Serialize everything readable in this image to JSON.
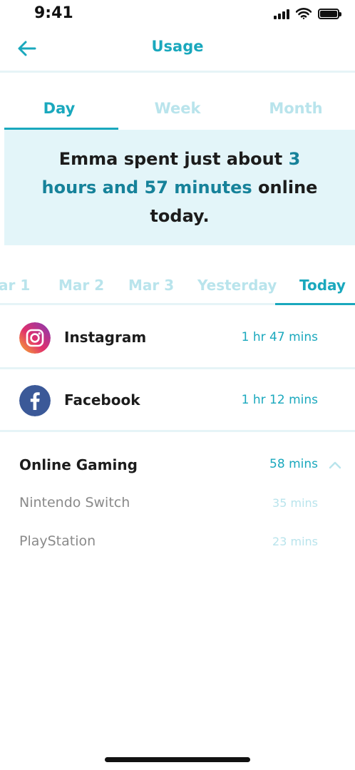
{
  "status_bar": {
    "time": "9:41"
  },
  "nav": {
    "title": "Usage",
    "back_icon": "arrow-left-icon"
  },
  "period_tabs": [
    {
      "label": "Day",
      "active": true
    },
    {
      "label": "Week",
      "active": false
    },
    {
      "label": "Month",
      "active": false
    }
  ],
  "summary": {
    "prefix": "Emma spent just about ",
    "highlight": "3 hours and 57 minutes",
    "suffix": " online today."
  },
  "day_tabs": [
    {
      "label": "ar 1",
      "active": false
    },
    {
      "label": "Mar 2",
      "active": false
    },
    {
      "label": "Mar 3",
      "active": false
    },
    {
      "label": "Yesterday",
      "active": false
    },
    {
      "label": "Today",
      "active": true
    }
  ],
  "apps": [
    {
      "name": "Instagram",
      "time": "1 hr 47 mins",
      "icon": "instagram-icon"
    },
    {
      "name": "Facebook",
      "time": "1 hr 12 mins",
      "icon": "facebook-icon"
    }
  ],
  "category": {
    "name": "Online Gaming",
    "time": "58 mins",
    "icon": "chevron-up-icon",
    "items": [
      {
        "name": "Nintendo Switch",
        "time": "35 mins"
      },
      {
        "name": "PlayStation",
        "time": "23 mins"
      }
    ]
  },
  "colors": {
    "accent": "#1aa8bd",
    "accent_dark": "#16829a",
    "accent_light": "#b9e4ec",
    "banner_bg": "#e3f5f9"
  }
}
